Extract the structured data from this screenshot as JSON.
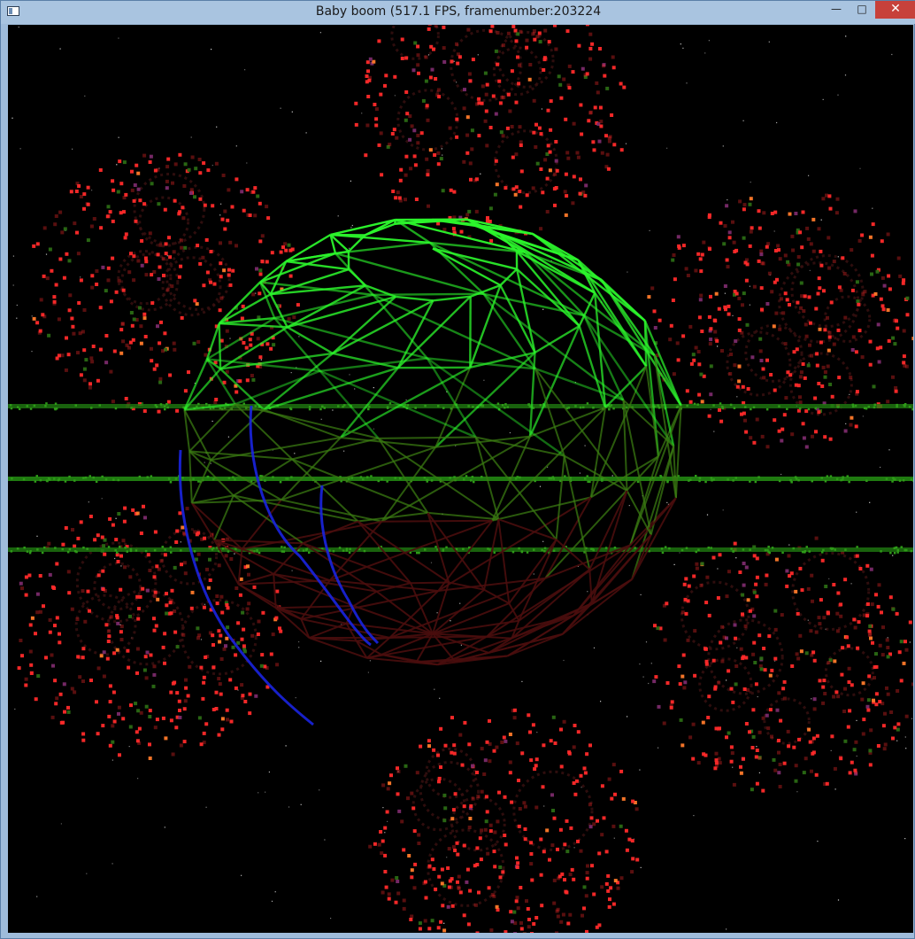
{
  "window": {
    "title": "Baby boom (517.1 FPS, framenumber:203224",
    "controls": {
      "minimize": "—",
      "maximize": "□",
      "close": "✕"
    }
  },
  "icons": [
    "app-window-icon",
    "minimize-icon",
    "maximize-icon",
    "close-icon"
  ],
  "colors": {
    "background": "#000000",
    "wireframe_bright": "#2cf52c",
    "wireframe_dim": "#3a7a12",
    "wireframe_blue": "#1a24e0",
    "wireframe_red": "#4a0e0e",
    "particles": "#ff2a2a",
    "ground_lines": "#1f7a10",
    "close_button": "#c7413b"
  }
}
